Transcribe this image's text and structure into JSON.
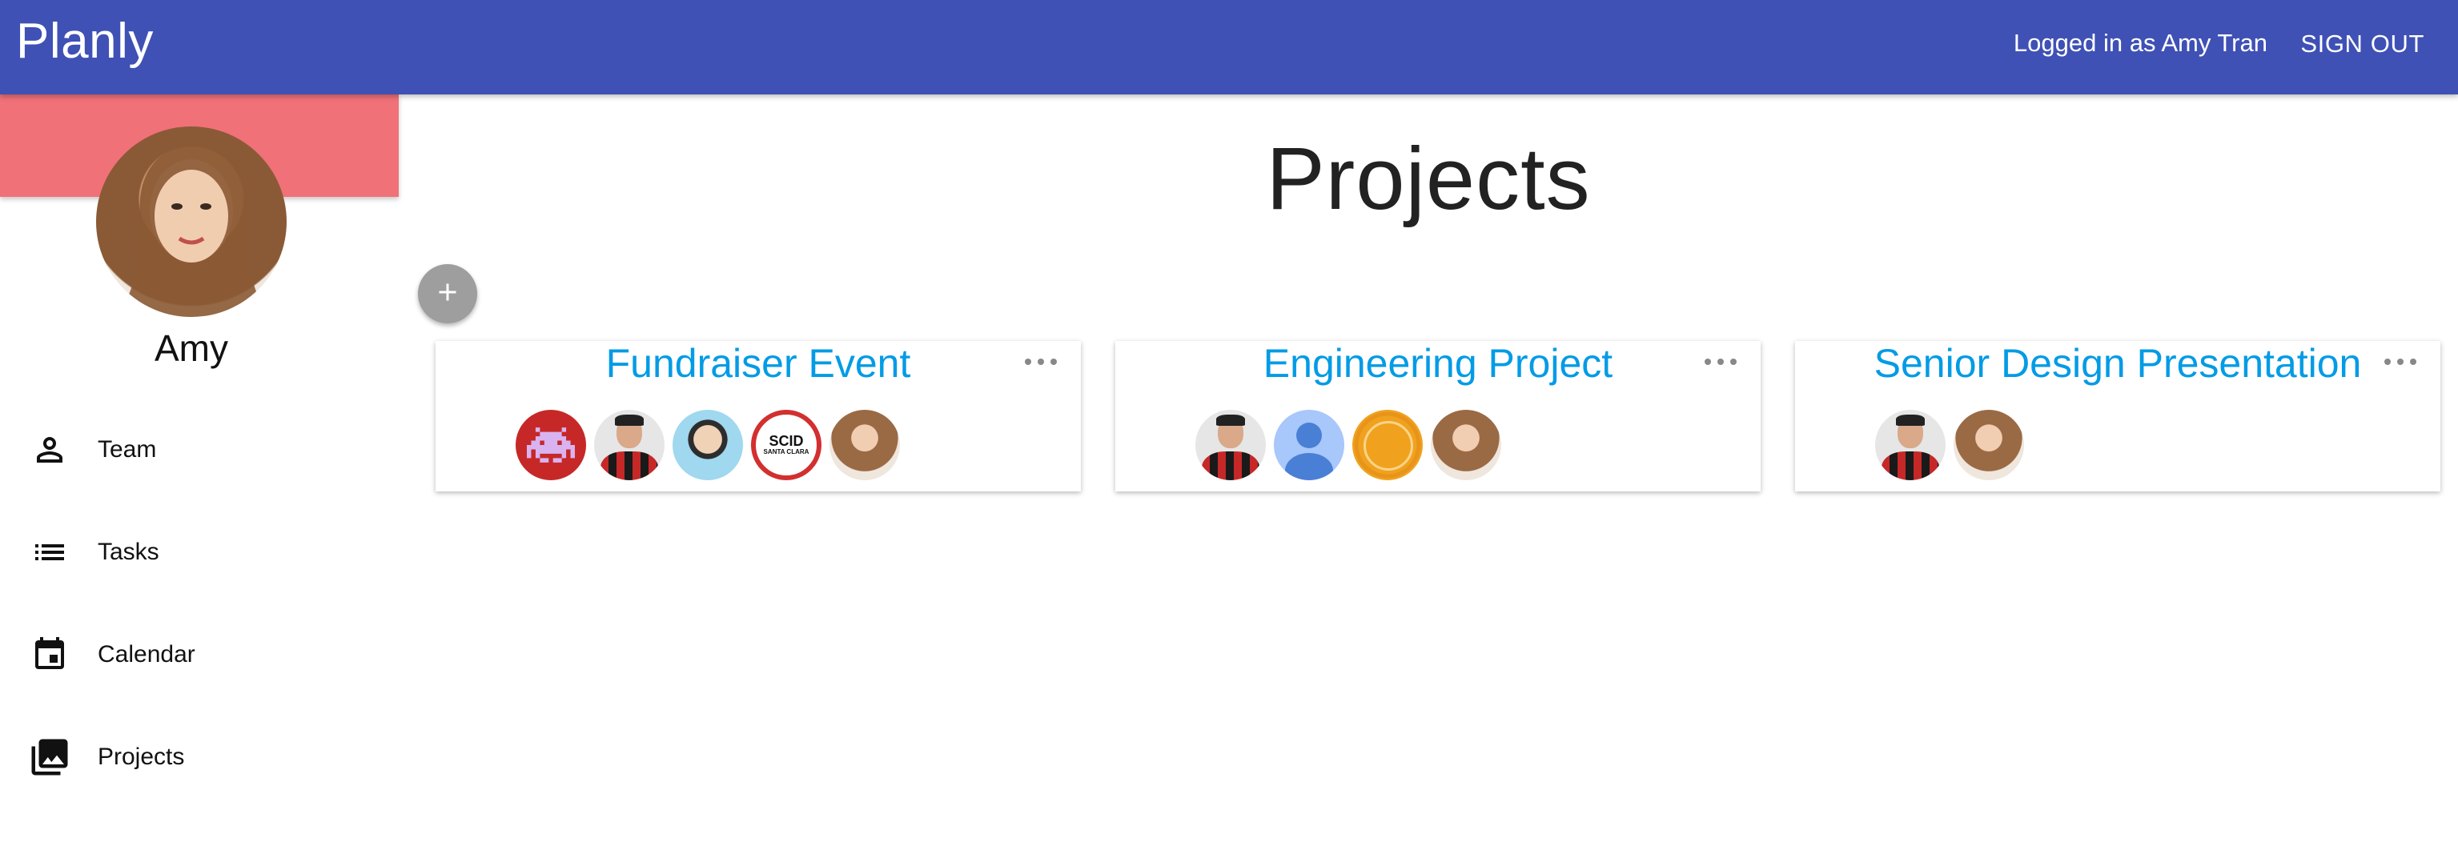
{
  "app": {
    "brand": "Planly"
  },
  "header": {
    "logged_in_text": "Logged in as Amy Tran",
    "sign_out_label": "SIGN OUT"
  },
  "sidebar": {
    "profile_name": "Amy",
    "nav": [
      {
        "label": "Team",
        "icon": "person-icon"
      },
      {
        "label": "Tasks",
        "icon": "list-icon"
      },
      {
        "label": "Calendar",
        "icon": "calendar-icon"
      },
      {
        "label": "Projects",
        "icon": "photo-library-icon"
      }
    ]
  },
  "main": {
    "title": "Projects",
    "add_button_icon": "plus-icon",
    "projects": [
      {
        "title": "Fundraiser Event",
        "members": [
          "space-invader-avatar",
          "man-plaid-shirt-avatar",
          "boy-avatar",
          "scid-logo-avatar",
          "amy-avatar"
        ],
        "scid_text": "SCID",
        "scid_subtext": "SANTA CLARA"
      },
      {
        "title": "Engineering Project",
        "members": [
          "man-plaid-shirt-avatar",
          "default-user-avatar",
          "seal-avatar",
          "amy-avatar"
        ]
      },
      {
        "title": "Senior Design Presentation",
        "members": [
          "man-plaid-shirt-avatar",
          "amy-avatar"
        ]
      }
    ]
  },
  "colors": {
    "appbar": "#3f51b5",
    "cover": "#f07178",
    "project_title": "#039be5",
    "fab": "#9e9e9e"
  }
}
